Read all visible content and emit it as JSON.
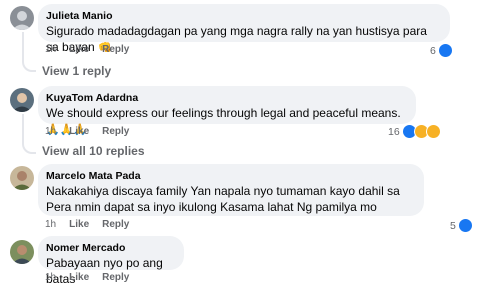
{
  "comments": [
    {
      "author": "Julieta Manio",
      "text": "Sigurado madadagdagan pa yang mga nagra rally na yan hustisya para sa bayan",
      "emoji": "👊",
      "time": "1h",
      "like": "Like",
      "reply": "Reply",
      "reactions": "6",
      "view_replies": "View 1 reply"
    },
    {
      "author": "KuyaTom Adardna",
      "text": "We should express our feelings through legal and peaceful means.",
      "emoji": "🙏🙏🙏",
      "time": "1h",
      "like": "Like",
      "reply": "Reply",
      "reactions": "16",
      "view_replies": "View all 10 replies"
    },
    {
      "author": "Marcelo Mata Pada",
      "text": "Nakakahiya discaya family Yan napala nyo tumaman kayo dahil sa Pera nmin dapat sa inyo ikulong Kasama lahat Ng pamilya mo",
      "time": "1h",
      "like": "Like",
      "reply": "Reply",
      "reactions": "5"
    },
    {
      "author": "Nomer Mercado",
      "text": "Pabayaan nyo po ang batas",
      "time": "1h",
      "like": "Like",
      "reply": "Reply"
    }
  ],
  "colors": {
    "bubble": "#f0f2f5",
    "secondary_text": "#65676b",
    "like_blue": "#1877f2",
    "emoji_yellow": "#f7b125"
  }
}
